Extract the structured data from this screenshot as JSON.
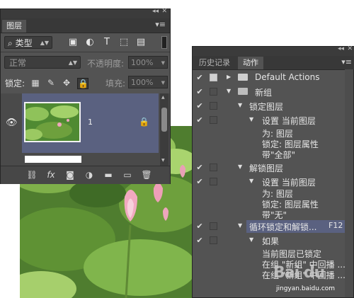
{
  "layers_panel": {
    "tab_label": "图层",
    "filter_kind": "类型",
    "blend_mode": "正常",
    "opacity_label": "不透明度:",
    "opacity_value": "100%",
    "lock_label": "锁定:",
    "fill_label": "填充:",
    "fill_value": "100%",
    "layer_name": "1"
  },
  "actions_panel": {
    "tabs": [
      "历史记录",
      "动作"
    ],
    "rows": [
      {
        "text": "Default Actions"
      },
      {
        "text": "新组"
      },
      {
        "text": "锁定图层"
      },
      {
        "text": "设置 当前图层"
      },
      {
        "text": "解锁图层"
      },
      {
        "text": "设置 当前图层"
      },
      {
        "text": "循环锁定和解锁...",
        "key": "F12"
      },
      {
        "text": "如果"
      }
    ],
    "sublines_1": [
      "为: 图层",
      "锁定: 图层属性",
      "带\"全部\""
    ],
    "sublines_2": [
      "为: 图层",
      "锁定: 图层属性",
      "带\"无\""
    ],
    "sublines_3": [
      "当前图层已锁定",
      "在组 \"新组\" 中回播 ...",
      "在组 \"新组\" 中回播 ..."
    ]
  },
  "watermark": {
    "logo": "Bai du",
    "url": "jingyan.baidu.com"
  }
}
